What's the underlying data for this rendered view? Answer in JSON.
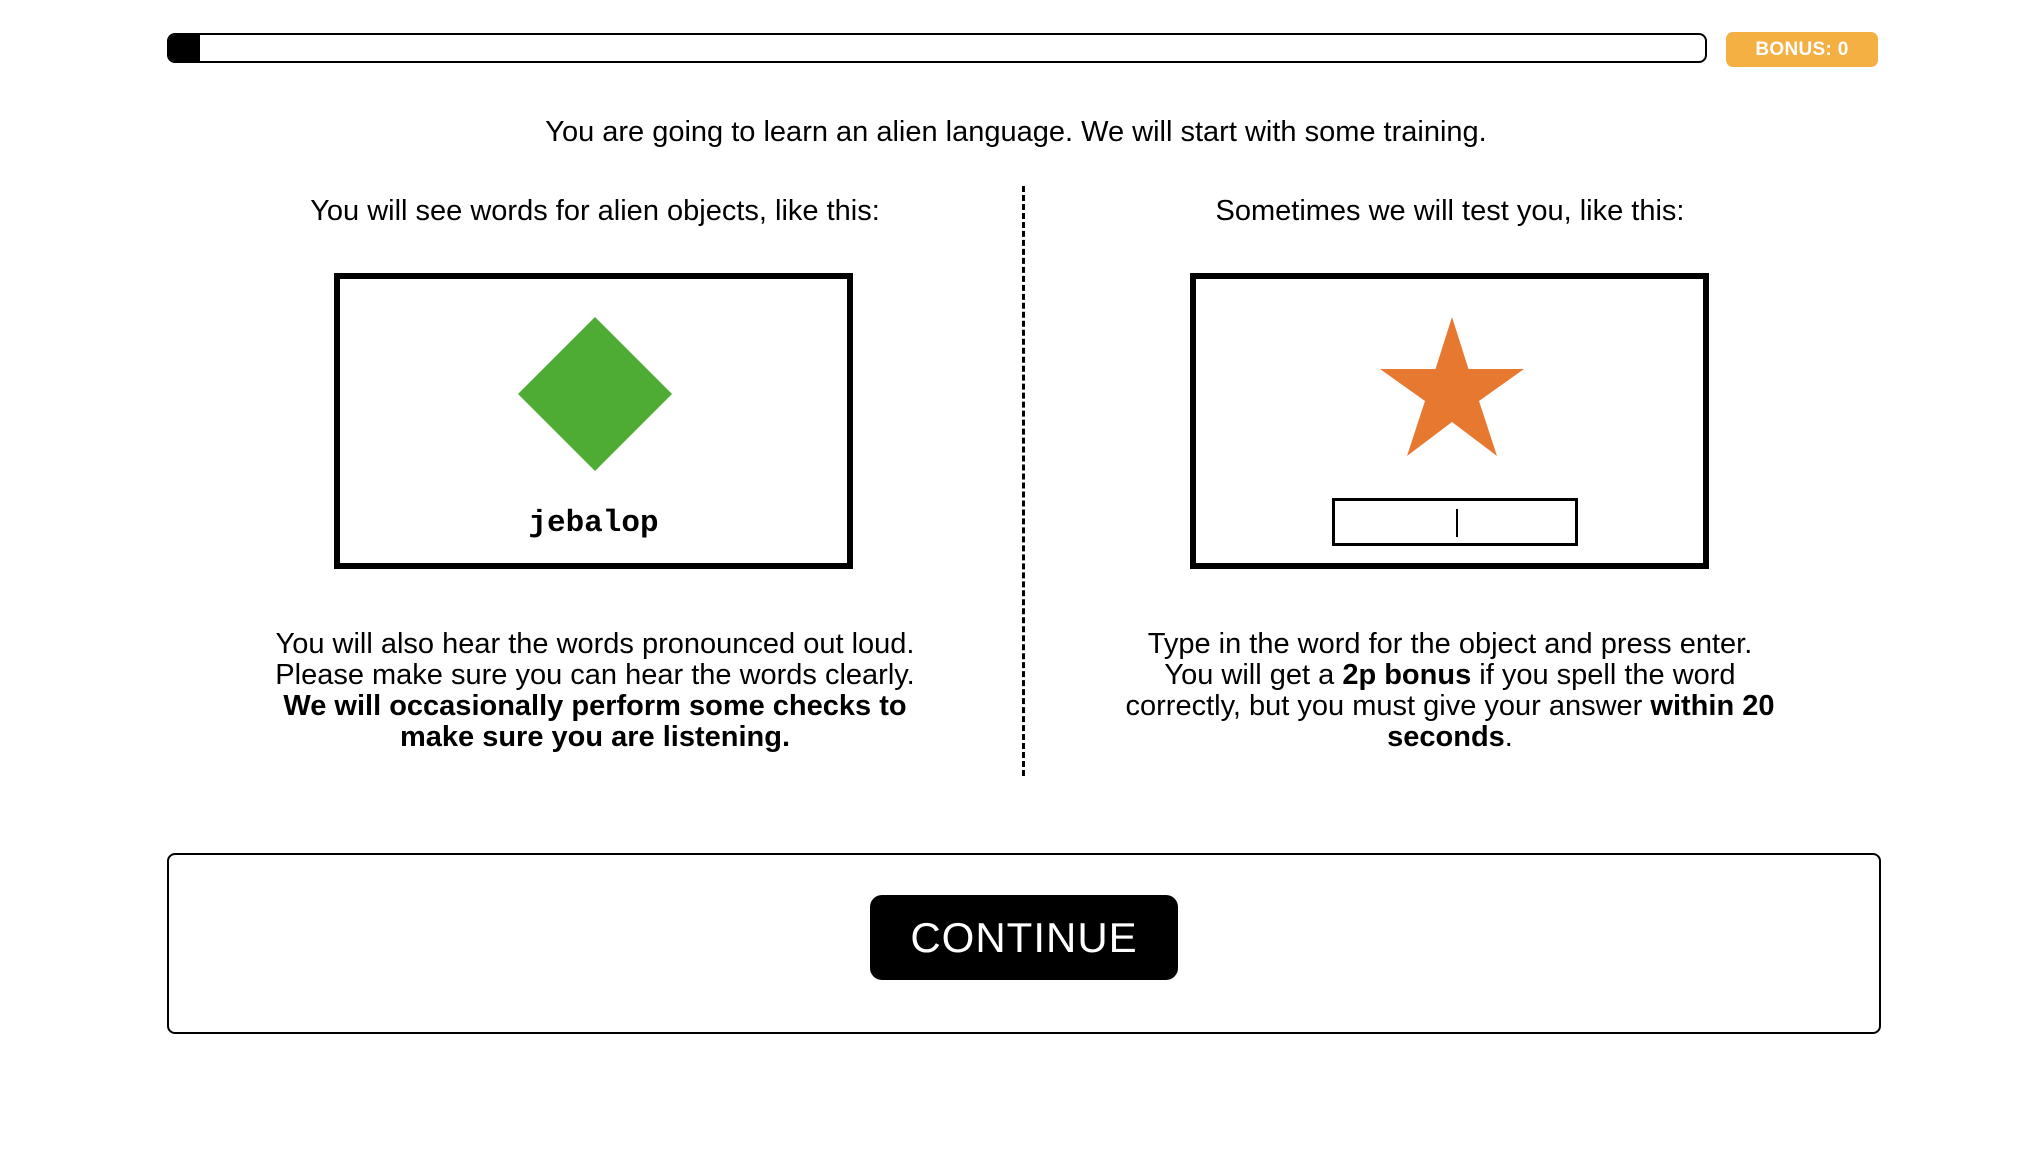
{
  "header": {
    "progress": 0.02,
    "bonus_label": "BONUS: 0"
  },
  "intro_text": "You are going to learn an alien language. We will start with some training.",
  "left_column": {
    "heading": "You will see words for alien objects, like this:",
    "example_word": "jebalop",
    "example_shape_color": "#4eac34",
    "example_shape": "green-diamond",
    "description_plain": "You will also hear the words pronounced out loud. Please make sure you can hear the words clearly.",
    "description_bold": "We will occasionally perform some checks to make sure you are listening."
  },
  "right_column": {
    "heading": "Sometimes we will test you, like this:",
    "example_shape_color": "#e7782f",
    "example_shape": "orange-star",
    "input_value": "",
    "description_part1": "Type in the word for the object and press enter. You will get a",
    "description_bold1": "2p bonus",
    "description_part2": "if you spell the word correctly, but you must give your answer",
    "description_bold2": "within 20 seconds",
    "description_end": "."
  },
  "footer": {
    "continue_label": "CONTINUE"
  },
  "colors": {
    "bonus_badge": "#f4b043",
    "button_bg": "#000000"
  }
}
